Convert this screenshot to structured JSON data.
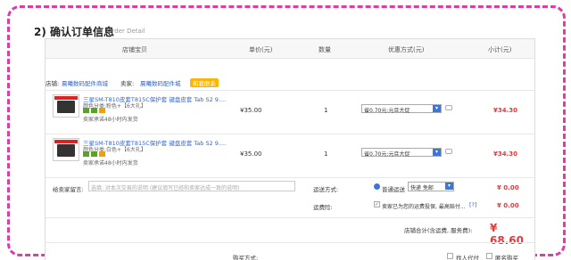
{
  "section": {
    "title": "2) 确认订单信息",
    "subtitle": "Order Detail"
  },
  "table": {
    "headers": [
      "店铺宝贝",
      "单价(元)",
      "数量",
      "优惠方式(元)",
      "小计(元)"
    ]
  },
  "store": {
    "label": "店铺:",
    "name": "晨曦数码配件商城",
    "seller_label": "卖家:",
    "seller": "晨曦数码配件城",
    "badge": "和我联系"
  },
  "items": [
    {
      "title": "三星SM-T810皮套T815C保护套 键盘皮套 Tab S2 9....",
      "attr": "颜色分类:粉色+【6大礼】",
      "note": "卖家承诺48小时内发货",
      "price": "¥35.00",
      "qty": "1",
      "promo": "省0.70元:元旦大促",
      "subtotal": "¥34.30"
    },
    {
      "title": "三星SM-T810皮套T815C保护套 键盘皮套 Tab S2 9....",
      "attr": "颜色分类:白色+【6大礼】",
      "note": "卖家承诺48小时内发货",
      "price": "¥35.00",
      "qty": "1",
      "promo": "省0.70元:元旦大促",
      "subtotal": "¥34.30"
    }
  ],
  "message": {
    "label": "给卖家留言:",
    "placeholder": "选填: 对本次交易的说明 (建议填写已经和卖家达成一致的说明)"
  },
  "shipping": {
    "label": "运送方式:",
    "option": "普通运送",
    "select": "快递 免邮",
    "fee": "¥ 0.00"
  },
  "insurance": {
    "label": "运费险:",
    "text": "卖家已为您的运费投保, 最高赔付...",
    "q": "[?]",
    "fee": "¥ 0.00"
  },
  "total": {
    "label": "店铺合计(含运费, 服务费):",
    "value": "¥ 68.60"
  },
  "payment": {
    "label": "购买方式:",
    "option1": "找人代付",
    "option2": "匿名购买"
  },
  "colors": {
    "accent": "#e23aa6",
    "price_red": "#e4393c",
    "link": "#3366cc"
  }
}
